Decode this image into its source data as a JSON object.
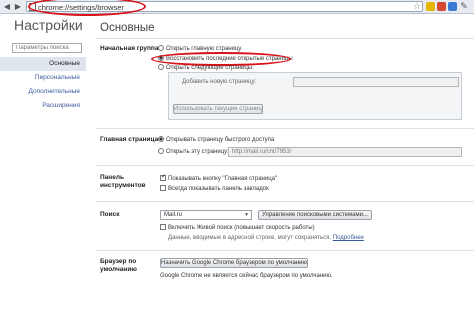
{
  "browser": {
    "url": "chrome://settings/browser"
  },
  "sidebar": {
    "title": "Настройки",
    "search_placeholder": "Параметры поиска",
    "items": [
      {
        "label": "Основные"
      },
      {
        "label": "Персональные"
      },
      {
        "label": "Дополнительные"
      },
      {
        "label": "Расширения"
      }
    ]
  },
  "main": {
    "title": "Основные",
    "startup": {
      "label": "Начальная группа",
      "option_home": "Открыть главную страницу",
      "option_restore": "Восстановить последние открытые страницы",
      "option_pages": "Открыть следующие страницы:",
      "add_page_placeholder": "Добавить новую страницу:",
      "use_current_button": "Использовать текущие страницы"
    },
    "homepage": {
      "label": "Главная страница",
      "option_ntp": "Открывать страницу быстрого доступа",
      "option_url": "Открыть эту страницу:",
      "url_value": "http://mail.ru/cnt/7953/"
    },
    "toolbar": {
      "label": "Панель инструментов",
      "show_home": "Показывать кнопку \"Главная страница\"",
      "show_bookmarks": "Всегда показывать панель закладок"
    },
    "search": {
      "label": "Поиск",
      "engine": "Mail.ru",
      "manage_button": "Управление поисковыми системами...",
      "instant_label": "Включить Живой поиск (повышает скорость работы)",
      "instant_hint": "Данные, вводимые в адресной строке, могут сохраняться.",
      "instant_link": "Подробнее"
    },
    "default_browser": {
      "label": "Браузер по умолчанию",
      "button": "Назначить Google Chrome браузером по умолчанию",
      "status": "Google Chrome не является сейчас браузером по умолчанию."
    }
  }
}
